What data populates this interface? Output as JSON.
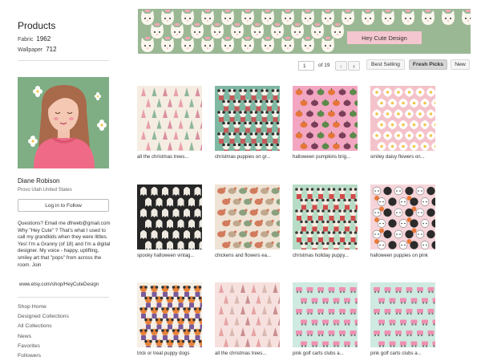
{
  "sidebar": {
    "products_title": "Products",
    "fabric_label": "Fabric",
    "fabric_count": "1962",
    "wallpaper_label": "Wallpaper",
    "wallpaper_count": "712",
    "user_name": "Diane Robison",
    "location": "Provo Utah United States",
    "follow_label": "Log in to Follow",
    "bio": "Questions? Email me dfrweb@gmail.com Why \"Hey Cute\" ? That's what I used to call my grandkids when they were littles. Yes! I'm a Granny (of 18) and I'm a digital designer. My voice - happy, uplifting, smiley art that \"pops\" from across the room. Join",
    "shop_url": "www.etsy.com/shop/HeyCuteDesign",
    "menu": [
      "Shop Home",
      "Designed Collections",
      "All Collections",
      "News",
      "Favorites",
      "Followers"
    ]
  },
  "banner": {
    "label": "Hey Cute Design"
  },
  "pagination": {
    "current_page": "1",
    "of_label": "of 19",
    "prev_icon": "chevron-left-icon",
    "next_icon": "chevron-right-icon"
  },
  "sort": {
    "options": [
      "Best Selling",
      "Fresh Picks",
      "New"
    ],
    "active": "Fresh Picks"
  },
  "products": [
    {
      "caption": "all the christmas trees...",
      "pattern": "trees-light"
    },
    {
      "caption": "christmas puppies on gr...",
      "pattern": "puppies-green"
    },
    {
      "caption": "halloween pumpkins brig...",
      "pattern": "pumpkins-pink"
    },
    {
      "caption": "smiley daisy flowers on...",
      "pattern": "daisies-pink"
    },
    {
      "caption": "spooky halloween vintag...",
      "pattern": "ghosts-black"
    },
    {
      "caption": "chickens and flowers ea...",
      "pattern": "chickens-beige"
    },
    {
      "caption": "christmas holiday puppy...",
      "pattern": "puppies-mint"
    },
    {
      "caption": "halloween puppies on pink",
      "pattern": "puppies-pink"
    },
    {
      "caption": "trick or treat puppy dogs",
      "pattern": "trick-cream"
    },
    {
      "caption": "all the christmas trees...",
      "pattern": "trees-pink"
    },
    {
      "caption": "pink golf carts clubs a...",
      "pattern": "golf-mint"
    },
    {
      "caption": "pink golf carts clubs a...",
      "pattern": "golf-mint2"
    }
  ],
  "colors": {
    "banner_bg": "#9bb895",
    "banner_label_bg": "#f4c6cf",
    "avatar_bg": "#7fae85",
    "sweater": "#ef6a86"
  }
}
